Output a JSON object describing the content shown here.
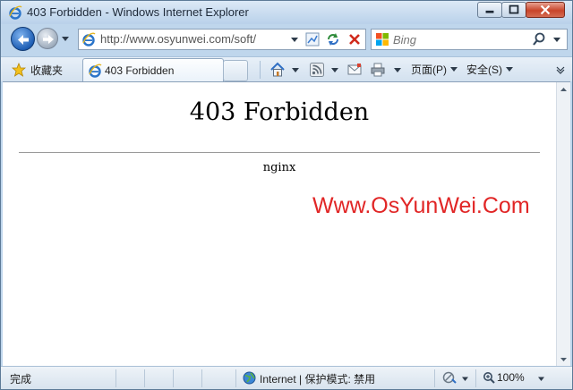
{
  "window": {
    "title": "403 Forbidden - Windows Internet Explorer"
  },
  "navigation": {
    "address": "http://www.osyunwei.com/soft/",
    "search_placeholder": "Bing",
    "icons": [
      "back-icon",
      "forward-icon",
      "compatibility-view-icon",
      "refresh-icon",
      "stop-icon",
      "search-icon"
    ]
  },
  "command_bar": {
    "favorites_label": "收藏夹",
    "tab_label": "403 Forbidden",
    "page_menu": "页面(P)",
    "safety_menu": "安全(S)",
    "icons": [
      "home-icon",
      "rss-feed-icon",
      "mail-icon",
      "print-icon"
    ]
  },
  "page": {
    "heading": "403 Forbidden",
    "server": "nginx",
    "watermark": "Www.OsYunWei.Com"
  },
  "status_bar": {
    "status": "完成",
    "zone": "Internet | 保护模式: 禁用",
    "zoom": "100%"
  },
  "colors": {
    "watermark": "#e12626",
    "frame": "#bfd6ec",
    "close_button": "#c8452b"
  }
}
